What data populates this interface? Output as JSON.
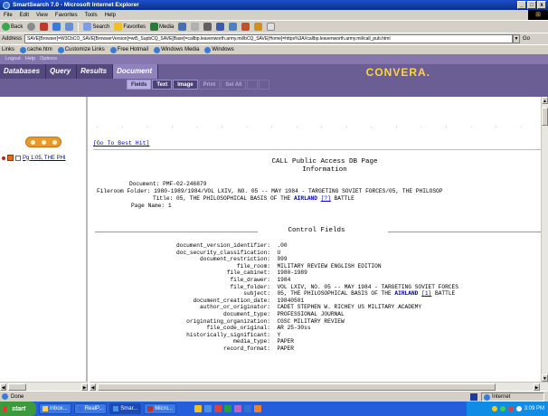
{
  "window": {
    "title": "SmartSearch 7.0 - Microsoft Internet Explorer",
    "controls": [
      "_",
      "□",
      "x"
    ]
  },
  "menu": [
    "File",
    "Edit",
    "View",
    "Favorites",
    "Tools",
    "Help"
  ],
  "toolbar": {
    "back": "Back",
    "search": "Search",
    "favorites": "Favorites",
    "media": "Media"
  },
  "address": {
    "label": "Address",
    "url": "SAVE[Browser]=W3CbCO_SAVE[BrowserVersion]=wt5_SupbCQ_SAVE[Base]=callbp.leavenworth.army.mil/bCQ_SAVE[Home]=https%3A//callbp.leavenworth.army.mil/call_pub.html",
    "go": "Go"
  },
  "links": {
    "label": "Links",
    "items": [
      "cache.htm",
      "Customize Links",
      "Free Hotmail",
      "Windows Media",
      "Windows"
    ]
  },
  "app": {
    "top_links": [
      "Logout",
      "Help",
      "Options"
    ],
    "nav_tabs": [
      "Databases",
      "Query",
      "Results",
      "Document"
    ],
    "brand": "CONVERA.",
    "doc_tabs": [
      "Fields",
      "Text",
      "Image",
      "Print",
      "Sel All"
    ]
  },
  "left": {
    "hit_label": "Pg 1:05, THE PHI"
  },
  "doc": {
    "goto_best": "[Go To Best Hit]",
    "dots": [
      ".",
      ".",
      ".",
      ".",
      ".",
      ".",
      ".",
      ".",
      ".",
      ".",
      ".",
      ".",
      ".",
      ".",
      ".",
      ".",
      ".",
      "."
    ],
    "header_title_1": "CALL Public Access DB Page",
    "header_title_2": "Information",
    "info": [
      {
        "label": "Document:",
        "value": "PMF-02-246879"
      },
      {
        "label": "Fileroom Folder:",
        "value": "1980-1989/1984/VOL LXIV, NO. 05 -- MAY 1984 - TARGETING SOVIET FORCES/05, THE PHILOSOP"
      },
      {
        "label": "Title:",
        "pre": "05, THE PHILOSOPHICAL BASIS OF THE ",
        "hl": "AIRLAND",
        "ref": "[?]",
        "post": " BATTLE"
      },
      {
        "label": "Page Name:",
        "value": "1"
      }
    ],
    "control_title": "Control Fields",
    "control": [
      {
        "label": "document_version_identifier:",
        "value": ".00"
      },
      {
        "label": "doc_security_classification:",
        "value": "U"
      },
      {
        "label": "document_restriction:",
        "value": "999"
      },
      {
        "label": "file_room:",
        "value": "MILITARY REVIEW ENGLISH EDITION"
      },
      {
        "label": "file_cabinet:",
        "value": "1980-1989"
      },
      {
        "label": "file_drawer:",
        "value": "1984"
      },
      {
        "label": "file_folder:",
        "value": "VOL LXIV, NO. 05 -- MAY 1984 - TARGETING SOVIET FORCES"
      },
      {
        "label": "subject:",
        "pre": "05, THE PHILOSOPHICAL BASIS OF THE ",
        "hl": "AIRLAND",
        "ref": "[1]",
        "post": " BATTLE"
      },
      {
        "label": "document_creation_date:",
        "value": "19840501"
      },
      {
        "label": "author_or_originator:",
        "value": "CADET STEPHEN W. RICHEY US MILITARY ACADEMY"
      },
      {
        "label": "document_type:",
        "value": "PROFESSIONAL JOURNAL"
      },
      {
        "label": "originating_organization:",
        "value": "CGSC MILITARY REVIEW"
      },
      {
        "label": "file_code_original:",
        "value": "AR 25-30ss"
      },
      {
        "label": "historically_significant:",
        "value": "Y"
      },
      {
        "label": "media_type:",
        "value": "PAPER"
      },
      {
        "label": "record_format:",
        "value": "PAPER"
      }
    ]
  },
  "status": {
    "left": "Done",
    "zone": "Internet"
  },
  "taskbar": {
    "start": "start",
    "items": [
      "Inbox...",
      "RealP...",
      "Smar...",
      "Micro..."
    ],
    "clock": "3:09 PM"
  },
  "colors": {
    "header": "#6b5e94",
    "brand": "#ffd43a",
    "taskbar": "#245edb",
    "link": "#0000cc"
  }
}
